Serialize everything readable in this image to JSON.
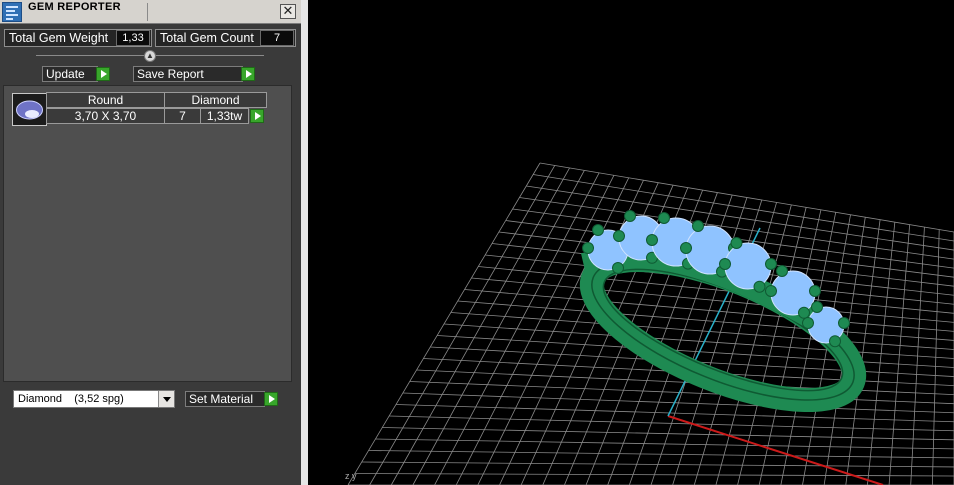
{
  "window": {
    "title": "GEM REPORTER",
    "close_glyph": "✕"
  },
  "stats": {
    "total_weight_label": "Total Gem Weight",
    "total_weight_value": "1,33",
    "total_count_label": "Total Gem Count",
    "total_count_value": "7"
  },
  "actions": {
    "update_label": "Update",
    "save_report_label": "Save Report"
  },
  "gem_table": {
    "rows": [
      {
        "shape": "Round",
        "type": "Diamond",
        "size": "3,70 X 3,70",
        "count": "7",
        "weight": "1,33tw"
      }
    ]
  },
  "material": {
    "selected": "Diamond    (3,52 spg)",
    "set_label": "Set Material"
  },
  "viewport": {
    "axis_label": "z y"
  },
  "colors": {
    "go_button": "#38a62b",
    "ring_metal": "#1e8a52",
    "gem": "#8fc3ff",
    "grid": "#8a8a8a",
    "axis_x": "#cc1a1a",
    "axis_y": "#2ab0c8"
  }
}
